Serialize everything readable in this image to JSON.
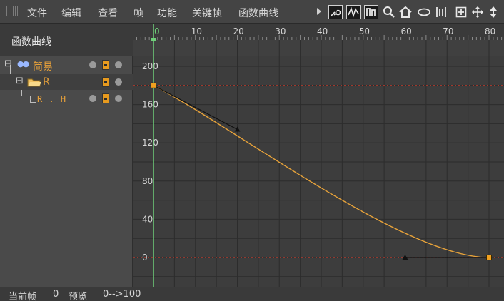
{
  "menu": {
    "items": [
      "文件",
      "编辑",
      "查看",
      "帧",
      "功能",
      "关键帧",
      "函数曲线"
    ]
  },
  "toolbar": {
    "icons": [
      "key-link-icon",
      "curve-spline-icon",
      "curve-step-icon",
      "zoom-icon",
      "home-icon",
      "ellipse-icon",
      "fit-columns-icon",
      "frame-view-icon",
      "pan-icon",
      "move-vertical-icon"
    ]
  },
  "side_panel": {
    "title": "函数曲线",
    "tree": [
      {
        "label": "简易",
        "depth": 0,
        "expand_glyph": "⊟"
      },
      {
        "label": "R",
        "depth": 1,
        "expand_glyph": "⊟"
      },
      {
        "label": "R . H",
        "depth": 2,
        "expand_glyph": ""
      }
    ]
  },
  "timeline": {
    "ruler_labels": [
      "0",
      "10",
      "20",
      "30",
      "40",
      "50",
      "60",
      "70",
      "80"
    ],
    "value_labels": [
      "200",
      "160",
      "120",
      "80",
      "40",
      "0"
    ]
  },
  "curve": {
    "x_min": 0,
    "x_max": 80,
    "keys": [
      {
        "frame": 0,
        "value": 180,
        "handle": {
          "frame": 20,
          "value": 134
        }
      },
      {
        "frame": 80,
        "value": 0,
        "handle": {
          "frame": 60,
          "value": 0
        }
      }
    ],
    "curve_color": "#e8a33a",
    "reference_line_color": "#c83a2a",
    "playhead_color": "#6fcf7a"
  },
  "status": {
    "current_frame_label": "当前帧",
    "current_frame_value": "0",
    "preview_label": "预览",
    "preview_range": "0-->100"
  }
}
